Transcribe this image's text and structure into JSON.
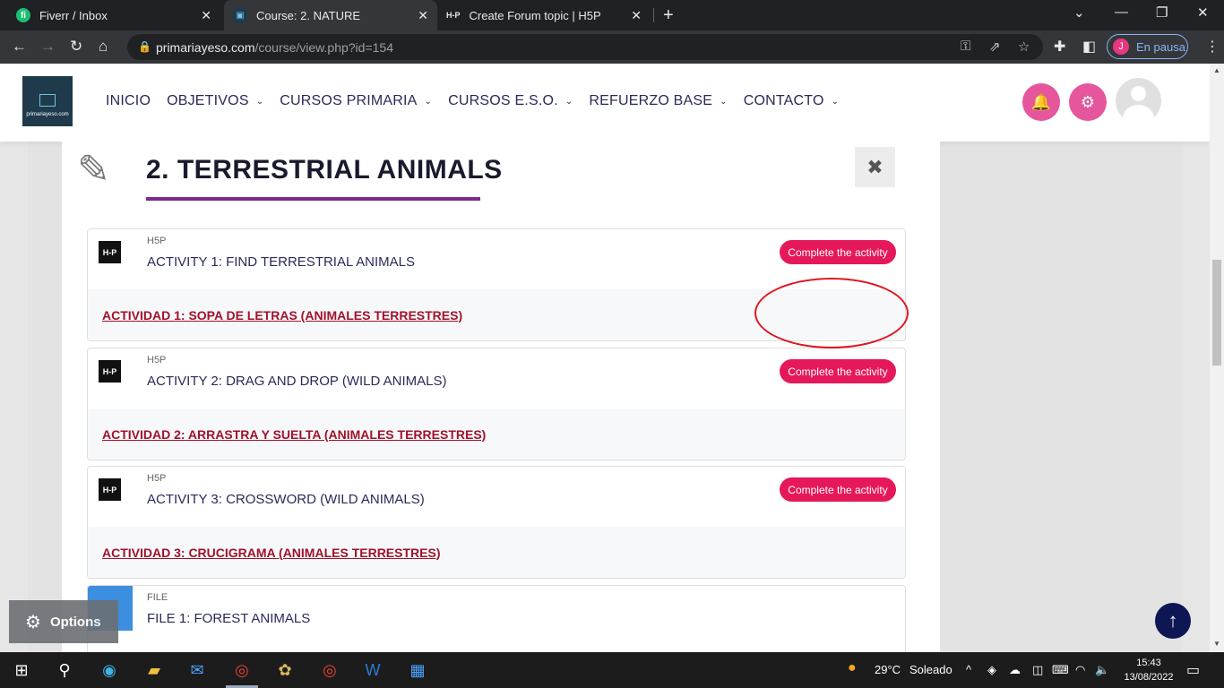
{
  "browser": {
    "tabs": [
      {
        "title": "Fiverr / Inbox",
        "active": false,
        "favicon": "fiverr-icon",
        "favicon_color": "#1dbf73",
        "favicon_glyph": "fi"
      },
      {
        "title": "Course: 2. NATURE",
        "active": true,
        "favicon": "site-icon",
        "favicon_color": "#1f3a4b",
        "favicon_glyph": "▣"
      },
      {
        "title": "Create Forum topic | H5P",
        "active": false,
        "favicon": "h5p-icon",
        "favicon_color": "#202124",
        "favicon_glyph": "H-P"
      }
    ],
    "url_domain": "primariayeso.com",
    "url_path": "/course/view.php?id=154",
    "profile_initial": "J",
    "profile_status": "En pausa"
  },
  "site": {
    "logo_text": "primariayeso.com",
    "menu": [
      {
        "label": "INICIO",
        "has_dropdown": false
      },
      {
        "label": "OBJETIVOS",
        "has_dropdown": true
      },
      {
        "label": "CURSOS PRIMARIA",
        "has_dropdown": true
      },
      {
        "label": "CURSOS E.S.O.",
        "has_dropdown": true
      },
      {
        "label": "REFUERZO BASE",
        "has_dropdown": true
      },
      {
        "label": "CONTACTO",
        "has_dropdown": true
      }
    ]
  },
  "section": {
    "title": "2. TERRESTRIAL ANIMALS",
    "close_glyph": "✖"
  },
  "activities": [
    {
      "type": "H5P",
      "name": "ACTIVITY 1: FIND TERRESTRIAL ANIMALS",
      "cta": "Complete the activity",
      "link": "ACTIVIDAD 1: SOPA DE LETRAS (ANIMALES TERRESTRES)",
      "icon": "h5p-icon"
    },
    {
      "type": "H5P",
      "name": "ACTIVITY 2: DRAG AND DROP (WILD ANIMALS)",
      "cta": "Complete the activity",
      "link": "ACTIVIDAD 2: ARRASTRA Y SUELTA (ANIMALES TERRESTRES)",
      "icon": "h5p-icon"
    },
    {
      "type": "H5P",
      "name": "ACTIVITY 3: CROSSWORD (WILD ANIMALS)",
      "cta": "Complete the activity",
      "link": "ACTIVIDAD 3:  CRUCIGRAMA (ANIMALES TERRESTRES)",
      "icon": "h5p-icon"
    },
    {
      "type": "FILE",
      "name": "FILE 1: FOREST ANIMALS",
      "icon": "file-icon"
    }
  ],
  "options_label": "Options",
  "taskbar": {
    "weather_temp": "29°C",
    "weather_desc": "Soleado",
    "time": "15:43",
    "date": "13/08/2022"
  },
  "colors": {
    "accent_pink": "#e5569c",
    "cta_red": "#e5185a",
    "link_red": "#a0122b",
    "title_underline": "#7a2c8a",
    "annotation_circle": "#e0141e"
  }
}
